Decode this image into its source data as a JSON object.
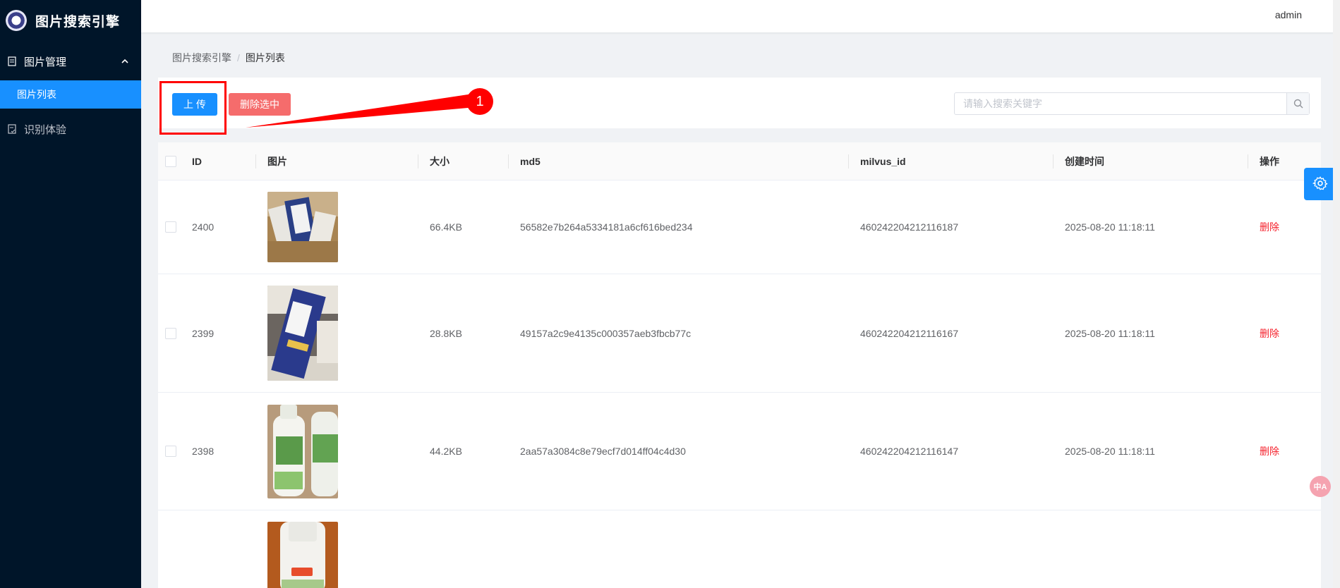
{
  "app": {
    "title": "图片搜索引擎",
    "user": "admin"
  },
  "sidebar": {
    "groups": [
      {
        "label": "图片管理",
        "items": [
          {
            "label": "图片列表",
            "active": true
          }
        ]
      },
      {
        "label": "识别体验"
      }
    ]
  },
  "breadcrumb": {
    "root": "图片搜索引擎",
    "separator": "/",
    "current": "图片列表"
  },
  "toolbar": {
    "upload_label": "上 传",
    "delete_label": "删除选中",
    "search_placeholder": "请输入搜索关键字"
  },
  "annotation": {
    "number": "1"
  },
  "table": {
    "columns": [
      "ID",
      "图片",
      "大小",
      "md5",
      "milvus_id",
      "创建时间",
      "操作"
    ],
    "rows": [
      {
        "id": "2400",
        "size": "66.4KB",
        "md5": "56582e7b264a5334181a6cf616bed234",
        "milvus_id": "460242204212116187",
        "created": "2025-08-20 11:18:11",
        "action": "删除",
        "thumb": "milk-box-cartons"
      },
      {
        "id": "2399",
        "size": "28.8KB",
        "md5": "49157a2c9e4135c000357aeb3fbcb77c",
        "milvus_id": "460242204212116167",
        "created": "2025-08-20 11:18:11",
        "action": "删除",
        "thumb": "milk-carton-blue"
      },
      {
        "id": "2398",
        "size": "44.2KB",
        "md5": "2aa57a3084c8e79ecf7d014ff04c4d30",
        "milvus_id": "460242204212116147",
        "created": "2025-08-20 11:18:11",
        "action": "删除",
        "thumb": "plant-drink-bottles"
      },
      {
        "id": "",
        "size": "",
        "md5": "",
        "milvus_id": "",
        "created": "",
        "action": "",
        "thumb": "white-bottle"
      }
    ]
  },
  "floating": {
    "settings_icon": "gear-icon",
    "translate_icon": "translate-icon",
    "translate_text": "中A"
  },
  "colors": {
    "sidebar_bg": "#001529",
    "primary": "#1890ff",
    "danger": "#f56c6c",
    "danger_text": "#f5222d",
    "annotation": "#ff0000"
  }
}
